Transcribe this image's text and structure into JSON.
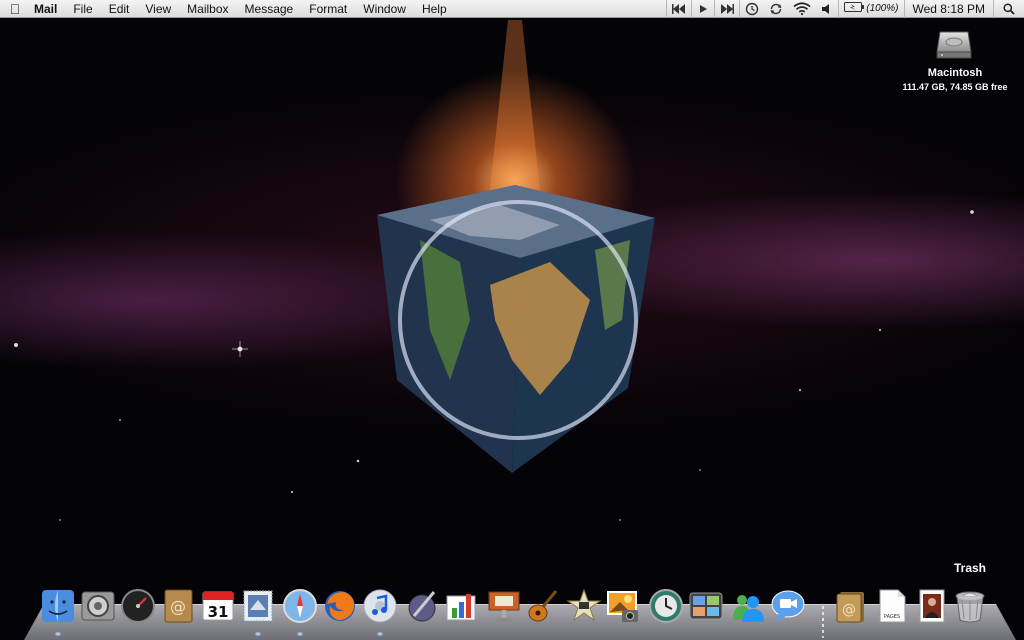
{
  "menubar": {
    "app_name": "Mail",
    "menus": [
      "File",
      "Edit",
      "View",
      "Mailbox",
      "Message",
      "Format",
      "Window",
      "Help"
    ],
    "battery_percent": "(100%)",
    "clock": "Wed 8:18 PM"
  },
  "desktop": {
    "drive_name": "Macintosh",
    "drive_info": "111.47 GB, 74.85 GB free",
    "trash_label": "Trash"
  },
  "dock": {
    "apps": [
      {
        "name": "Finder",
        "icon": "finder-icon"
      },
      {
        "name": "System Preferences",
        "icon": "system-preferences-icon"
      },
      {
        "name": "Dashboard",
        "icon": "dashboard-icon"
      },
      {
        "name": "Address Book",
        "icon": "address-book-icon"
      },
      {
        "name": "iCal",
        "icon": "ical-icon",
        "text": "31"
      },
      {
        "name": "Mail",
        "icon": "mail-stamp-icon"
      },
      {
        "name": "Safari",
        "icon": "safari-compass-icon"
      },
      {
        "name": "Firefox",
        "icon": "firefox-icon"
      },
      {
        "name": "iTunes",
        "icon": "itunes-icon"
      },
      {
        "name": "Script Editor",
        "icon": "script-editor-icon"
      },
      {
        "name": "Numbers",
        "icon": "numbers-chart-icon"
      },
      {
        "name": "Keynote",
        "icon": "keynote-podium-icon"
      },
      {
        "name": "GarageBand",
        "icon": "garageband-guitar-icon"
      },
      {
        "name": "iMovie",
        "icon": "imovie-star-icon"
      },
      {
        "name": "iPhoto",
        "icon": "iphoto-icon"
      },
      {
        "name": "Time Machine",
        "icon": "time-machine-icon"
      },
      {
        "name": "Spaces",
        "icon": "spaces-icon"
      },
      {
        "name": "Messenger",
        "icon": "messenger-buddies-icon"
      },
      {
        "name": "iChat",
        "icon": "ichat-bubble-icon"
      }
    ],
    "docs": [
      {
        "name": "Address stack",
        "icon": "address-stack-icon"
      },
      {
        "name": "Pages document",
        "icon": "pages-document-icon",
        "text": "PAGES"
      },
      {
        "name": "Photo document",
        "icon": "photo-document-icon"
      },
      {
        "name": "Trash",
        "icon": "trash-icon"
      }
    ]
  },
  "colors": {
    "menubar_bg": "#e8e8e8",
    "glow": "#ffb060",
    "nebula": "#8a3c7c"
  }
}
